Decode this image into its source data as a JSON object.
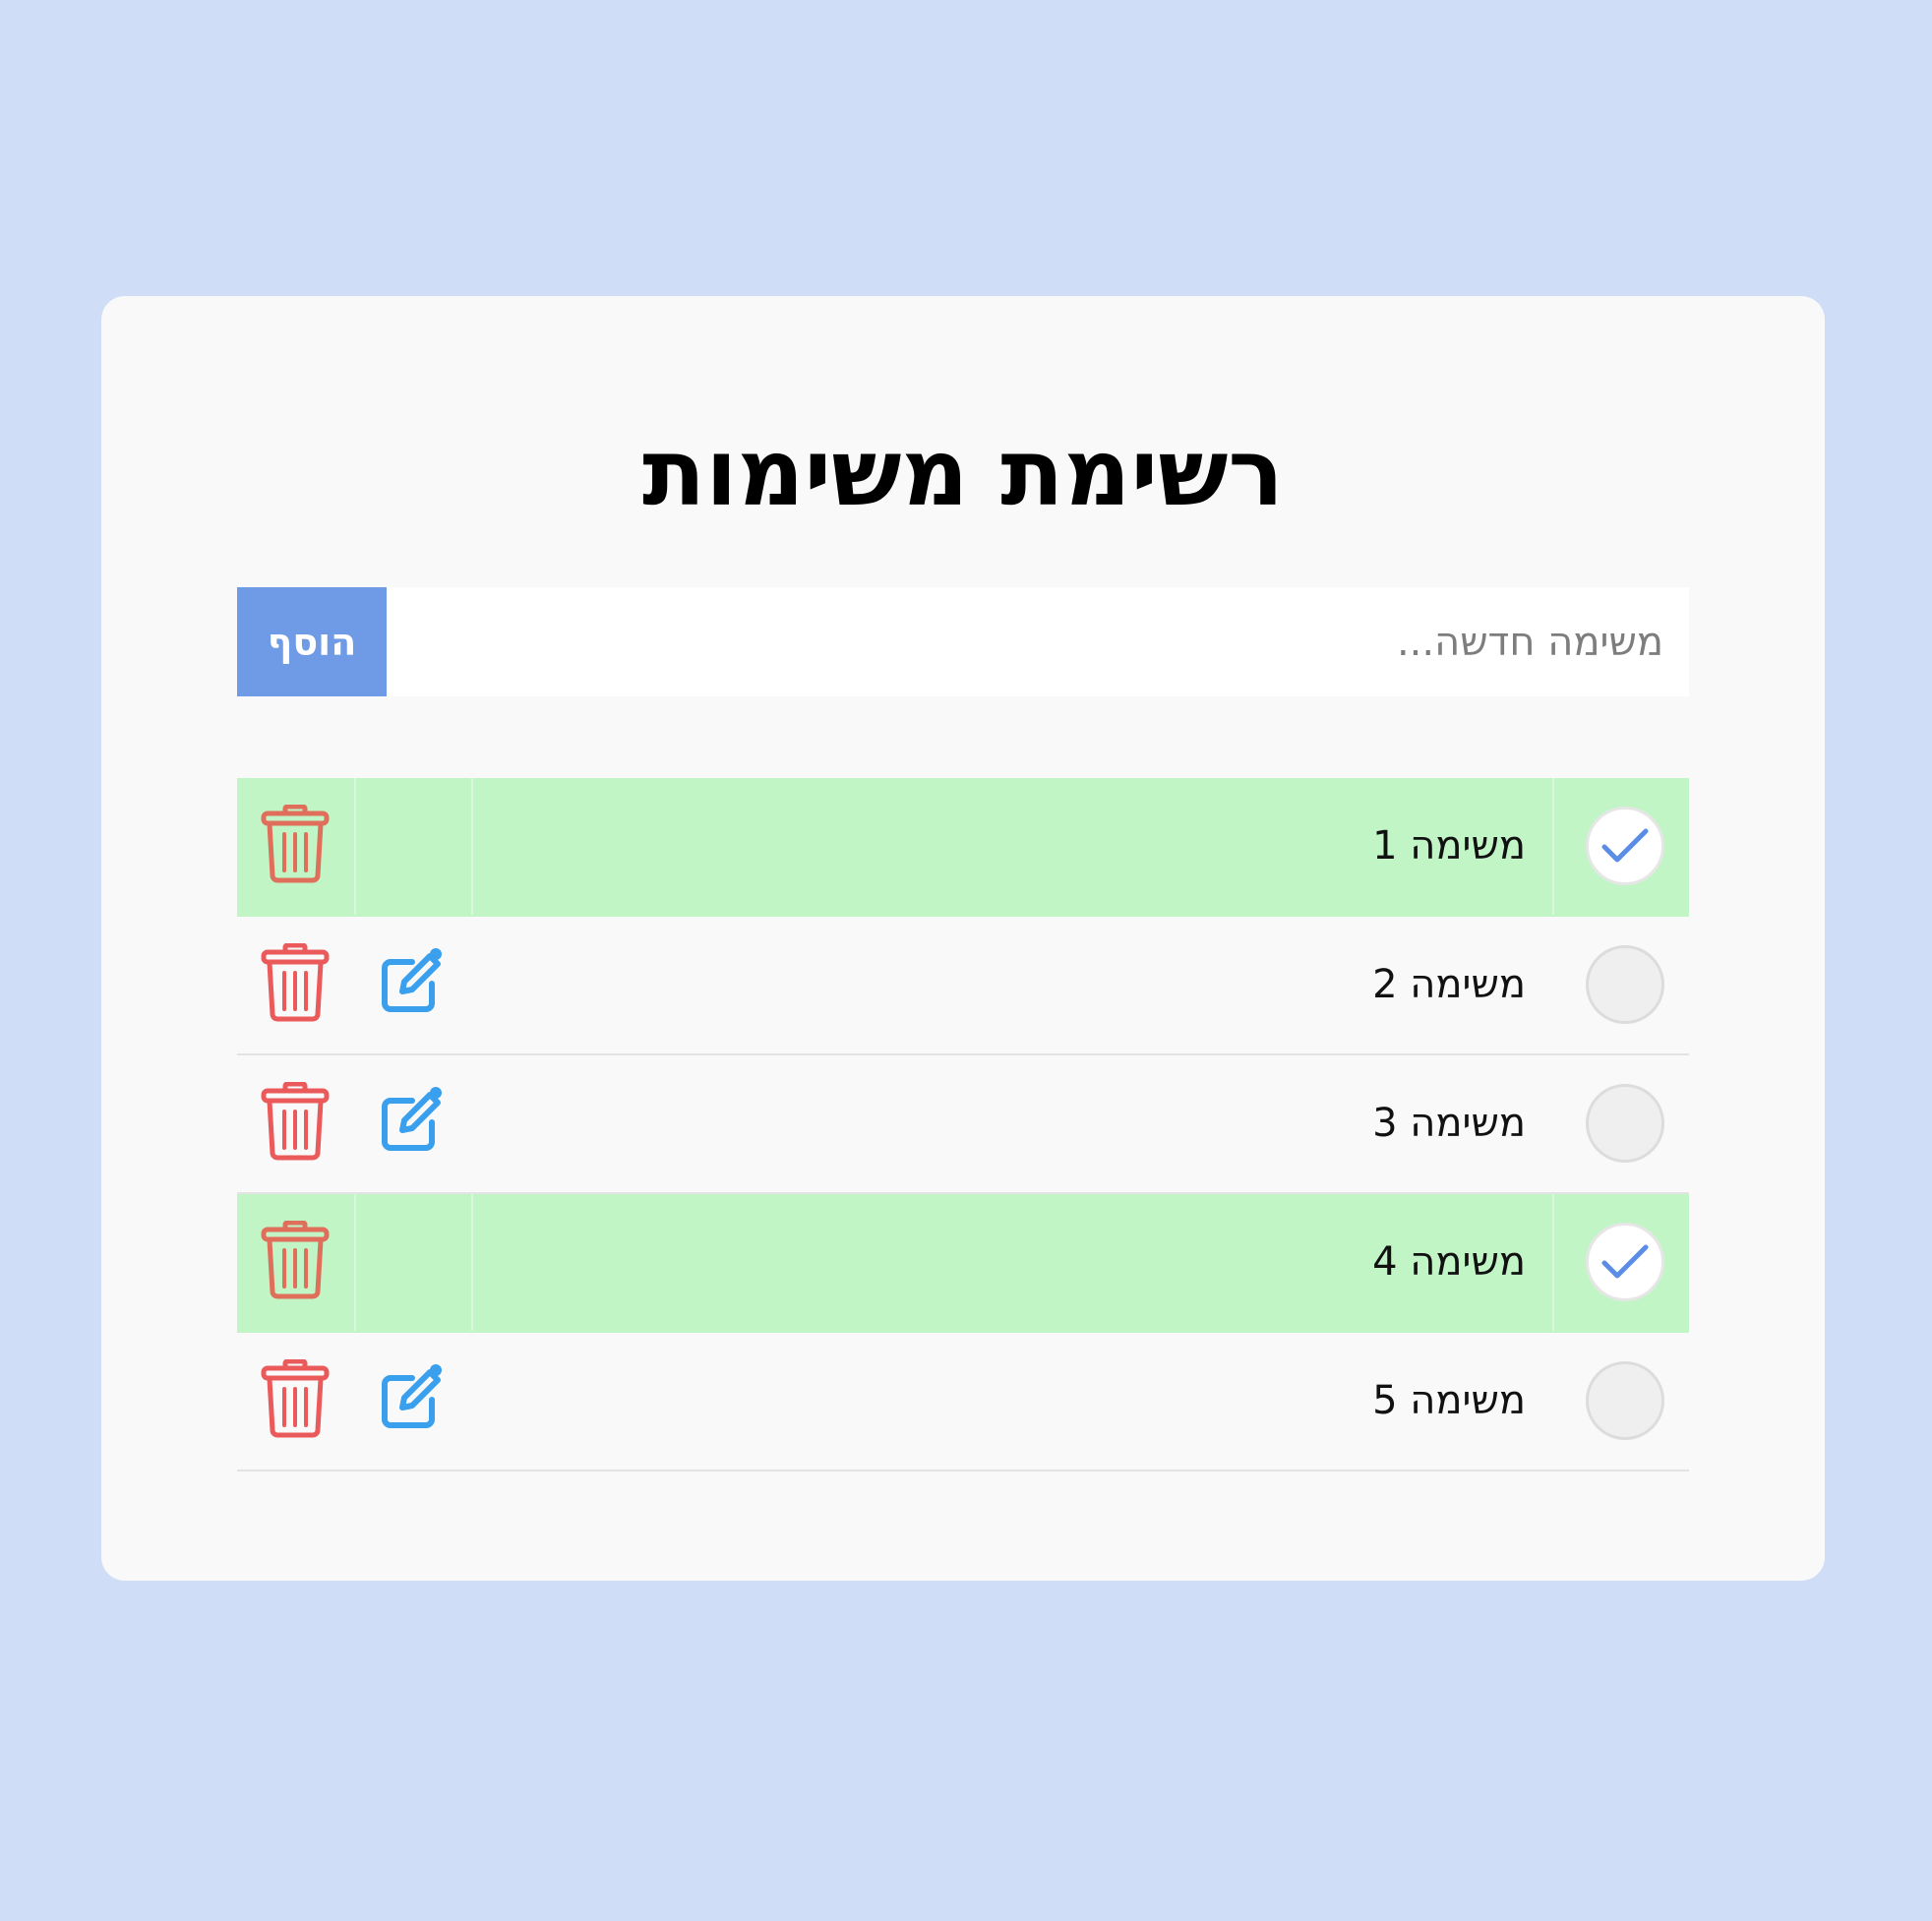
{
  "title": "רשימת משימות",
  "add_form": {
    "placeholder": "משימה חדשה...",
    "value": "",
    "button_label": "הוסף"
  },
  "tasks": [
    {
      "label": "משימה 1",
      "done": true
    },
    {
      "label": "משימה 2",
      "done": false
    },
    {
      "label": "משימה 3",
      "done": false
    },
    {
      "label": "משימה 4",
      "done": true
    },
    {
      "label": "משימה 5",
      "done": false
    }
  ],
  "icons": {
    "check": "check-icon",
    "delete": "trash-icon",
    "edit": "edit-icon"
  },
  "colors": {
    "page_background": "#cfdef6",
    "card_background": "#f9f9f9",
    "add_button": "#6f9ae6",
    "done_row": "#c2f5c6",
    "check_mark": "#5b8de6",
    "delete_icon": "#ea5a5a",
    "delete_icon_done": "#df6f5b",
    "edit_icon": "#3aa0ee"
  }
}
